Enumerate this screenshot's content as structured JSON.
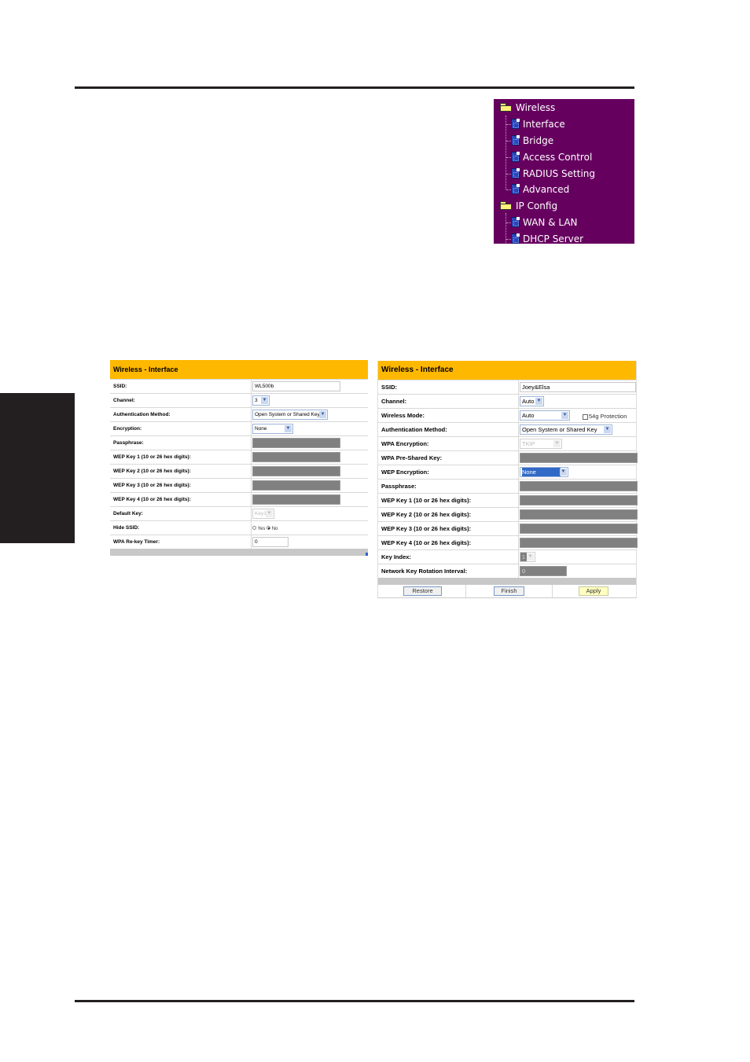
{
  "menu": {
    "groups": [
      {
        "label": "Wireless",
        "icon": "folder-open-icon",
        "items": [
          {
            "label": "Interface",
            "icon": "document-icon"
          },
          {
            "label": "Bridge",
            "icon": "document-icon"
          },
          {
            "label": "Access Control",
            "icon": "document-icon"
          },
          {
            "label": "RADIUS Setting",
            "icon": "document-icon"
          },
          {
            "label": "Advanced",
            "icon": "document-icon"
          }
        ]
      },
      {
        "label": "IP Config",
        "icon": "folder-open-icon",
        "items": [
          {
            "label": "WAN & LAN",
            "icon": "document-icon"
          },
          {
            "label": "DHCP Server",
            "icon": "document-icon"
          }
        ]
      }
    ]
  },
  "left_panel": {
    "title": "Wireless - Interface",
    "rows": [
      {
        "label": "SSID:",
        "value": "WL500b"
      },
      {
        "label": "Channel:",
        "value": "3"
      },
      {
        "label": "Authentication Method:",
        "value": "Open System or Shared Key"
      },
      {
        "label": "Encryption:",
        "value": "None"
      },
      {
        "label": "Passphrase:",
        "value": ""
      },
      {
        "label": "WEP Key 1 (10 or 26 hex digits):",
        "value": ""
      },
      {
        "label": "WEP Key 2 (10 or 26 hex digits):",
        "value": ""
      },
      {
        "label": "WEP Key 3 (10 or 26 hex digits):",
        "value": ""
      },
      {
        "label": "WEP Key 4 (10 or 26 hex digits):",
        "value": ""
      },
      {
        "label": "Default Key:",
        "value": "Key1"
      },
      {
        "label": "Hide SSID:",
        "options": [
          "Yes",
          "No"
        ],
        "selected": "No"
      },
      {
        "label": "WPA Re-key Timer:",
        "value": "0"
      }
    ]
  },
  "right_panel": {
    "title": "Wireless - Interface",
    "rows": [
      {
        "label": "SSID:",
        "value": "Joey&Elsa"
      },
      {
        "label": "Channel:",
        "value": "Auto"
      },
      {
        "label": "Wireless Mode:",
        "value": "Auto",
        "checkbox_label": "54g Protection",
        "checkbox_checked": false
      },
      {
        "label": "Authentication Method:",
        "value": "Open System or Shared Key"
      },
      {
        "label": "WPA Encryption:",
        "value": "TKIP"
      },
      {
        "label": "WPA Pre-Shared Key:",
        "value": ""
      },
      {
        "label": "WEP Encryption:",
        "value": "None"
      },
      {
        "label": "Passphrase:",
        "value": ""
      },
      {
        "label": "WEP Key 1 (10 or 26 hex digits):",
        "value": ""
      },
      {
        "label": "WEP Key 2 (10 or 26 hex digits):",
        "value": ""
      },
      {
        "label": "WEP Key 3 (10 or 26 hex digits):",
        "value": ""
      },
      {
        "label": "WEP Key 4 (10 or 26 hex digits):",
        "value": ""
      },
      {
        "label": "Key Index:",
        "value": "1"
      },
      {
        "label": "Network Key Rotation Interval:",
        "value": "0"
      }
    ],
    "buttons": {
      "restore": "Restore",
      "finish": "Finish",
      "apply": "Apply"
    }
  },
  "colors": {
    "menu_bg": "#66005f",
    "header_bg": "#ffb800",
    "disabled_field": "#808080",
    "page_rule": "#231f20"
  }
}
